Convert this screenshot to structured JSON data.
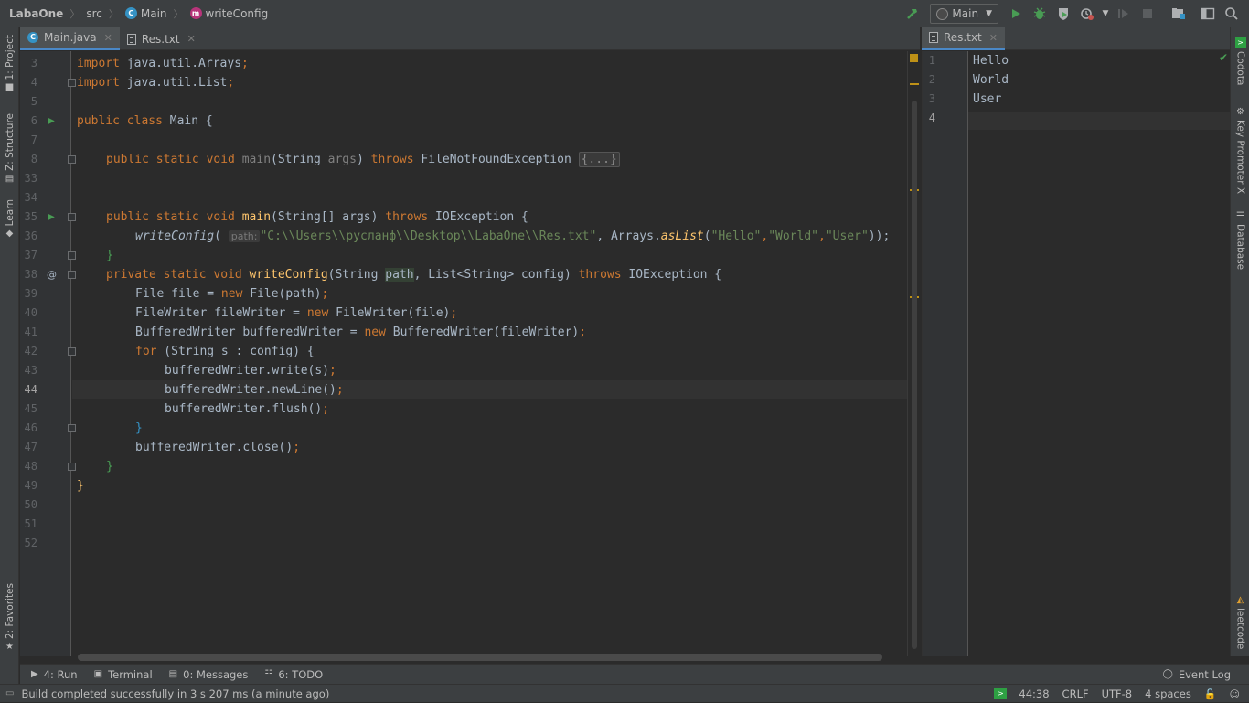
{
  "breadcrumb": {
    "project": "LabaOne",
    "folder": "src",
    "class": "Main",
    "method": "writeConfig"
  },
  "run_config": "Main",
  "left_tool_tabs": [
    "1: Project",
    "Z: Structure",
    "Learn",
    "2: Favorites"
  ],
  "right_tool_tabs": [
    "Codota",
    "Key Promoter X",
    "Database",
    "leetcode"
  ],
  "editor_left": {
    "tabs": [
      {
        "label": "Main.java",
        "active": true
      },
      {
        "label": "Res.txt",
        "active": false
      }
    ],
    "current_line": "44",
    "line_numbers": [
      "3",
      "4",
      "5",
      "6",
      "7",
      "8",
      "33",
      "34",
      "35",
      "36",
      "37",
      "38",
      "39",
      "40",
      "41",
      "42",
      "43",
      "44",
      "45",
      "46",
      "47",
      "48",
      "49",
      "50",
      "51",
      "52"
    ],
    "gutter_marks": {
      "6": "run",
      "35": "run",
      "38": "@"
    }
  },
  "code": {
    "l3_a": "import",
    "l3_b": " java.util.Arrays",
    "l3_c": ";",
    "l4_a": "import",
    "l4_b": " java.util.List",
    "l4_c": ";",
    "l6_a": "public class",
    "l6_b": " Main {",
    "l8_a": "public static void",
    "l8_b": " main",
    "l8_c": "(String ",
    "l8_d": "args",
    "l8_e": ") ",
    "l8_f": "throws",
    "l8_g": " FileNotFoundException ",
    "l8_h": "{...}",
    "l35_a": "public static void",
    "l35_b": "main",
    "l35_c": "(String[] args) ",
    "l35_d": "throws",
    "l35_e": " IOException {",
    "l36_a": "writeConfig",
    "l36_b": "(",
    "l36_hint": "path:",
    "l36_c": "\"C:\\\\Users\\\\русланф\\\\Desktop\\\\LabaOne\\\\Res.txt\"",
    "l36_d": ", Arrays.",
    "l36_e": "asList",
    "l36_f": "(",
    "l36_g": "\"Hello\"",
    "l36_h": ",",
    "l36_i": "\"World\"",
    "l36_j": ",",
    "l36_k": "\"User\"",
    "l36_l": "));",
    "l37_a": "}",
    "l38_a": "private static void",
    "l38_b": "writeConfig",
    "l38_c": "(String ",
    "l38_d": "path",
    "l38_e": ", List<String> config) ",
    "l38_f": "throws",
    "l38_g": " IOException {",
    "l39_a": "File file = ",
    "l39_b": "new",
    "l39_c": " File(path)",
    "l39_d": ";",
    "l40_a": "FileWriter fileWriter = ",
    "l40_b": "new",
    "l40_c": " FileWriter(file)",
    "l40_d": ";",
    "l41_a": "BufferedWriter bufferedWriter = ",
    "l41_b": "new",
    "l41_c": " BufferedWriter(fileWriter)",
    "l41_d": ";",
    "l42_a": "for",
    "l42_b": " (String s : config) {",
    "l43_a": "bufferedWriter.write(s)",
    "l43_b": ";",
    "l44_a": "bufferedWriter.newLine()",
    "l44_b": ";",
    "l45_a": "bufferedWriter.flush()",
    "l45_b": ";",
    "l46_a": "}",
    "l47_a": "bufferedWriter.close()",
    "l47_b": ";",
    "l48_a": "}",
    "l49_a": "}"
  },
  "editor_right": {
    "tabs": [
      {
        "label": "Res.txt",
        "active": true
      }
    ],
    "line_numbers": [
      "1",
      "2",
      "3",
      "4"
    ],
    "lines": [
      "Hello",
      "World",
      "User",
      ""
    ]
  },
  "bottom_tools": [
    {
      "label": "4: Run",
      "icon": "run-icon"
    },
    {
      "label": "Terminal",
      "icon": "terminal-icon"
    },
    {
      "label": "0: Messages",
      "icon": "messages-icon"
    },
    {
      "label": "6: TODO",
      "icon": "todo-icon"
    }
  ],
  "event_log": "Event Log",
  "status": {
    "message": "Build completed successfully in 3 s 207 ms (a minute ago)",
    "position": "44:38",
    "line_sep": "CRLF",
    "encoding": "UTF-8",
    "indent": "4 spaces"
  },
  "colors": {
    "keyword": "#cc7832",
    "method": "#ffc66d",
    "string": "#6a8759",
    "accent": "#4a88c7",
    "run_green": "#499c54"
  }
}
